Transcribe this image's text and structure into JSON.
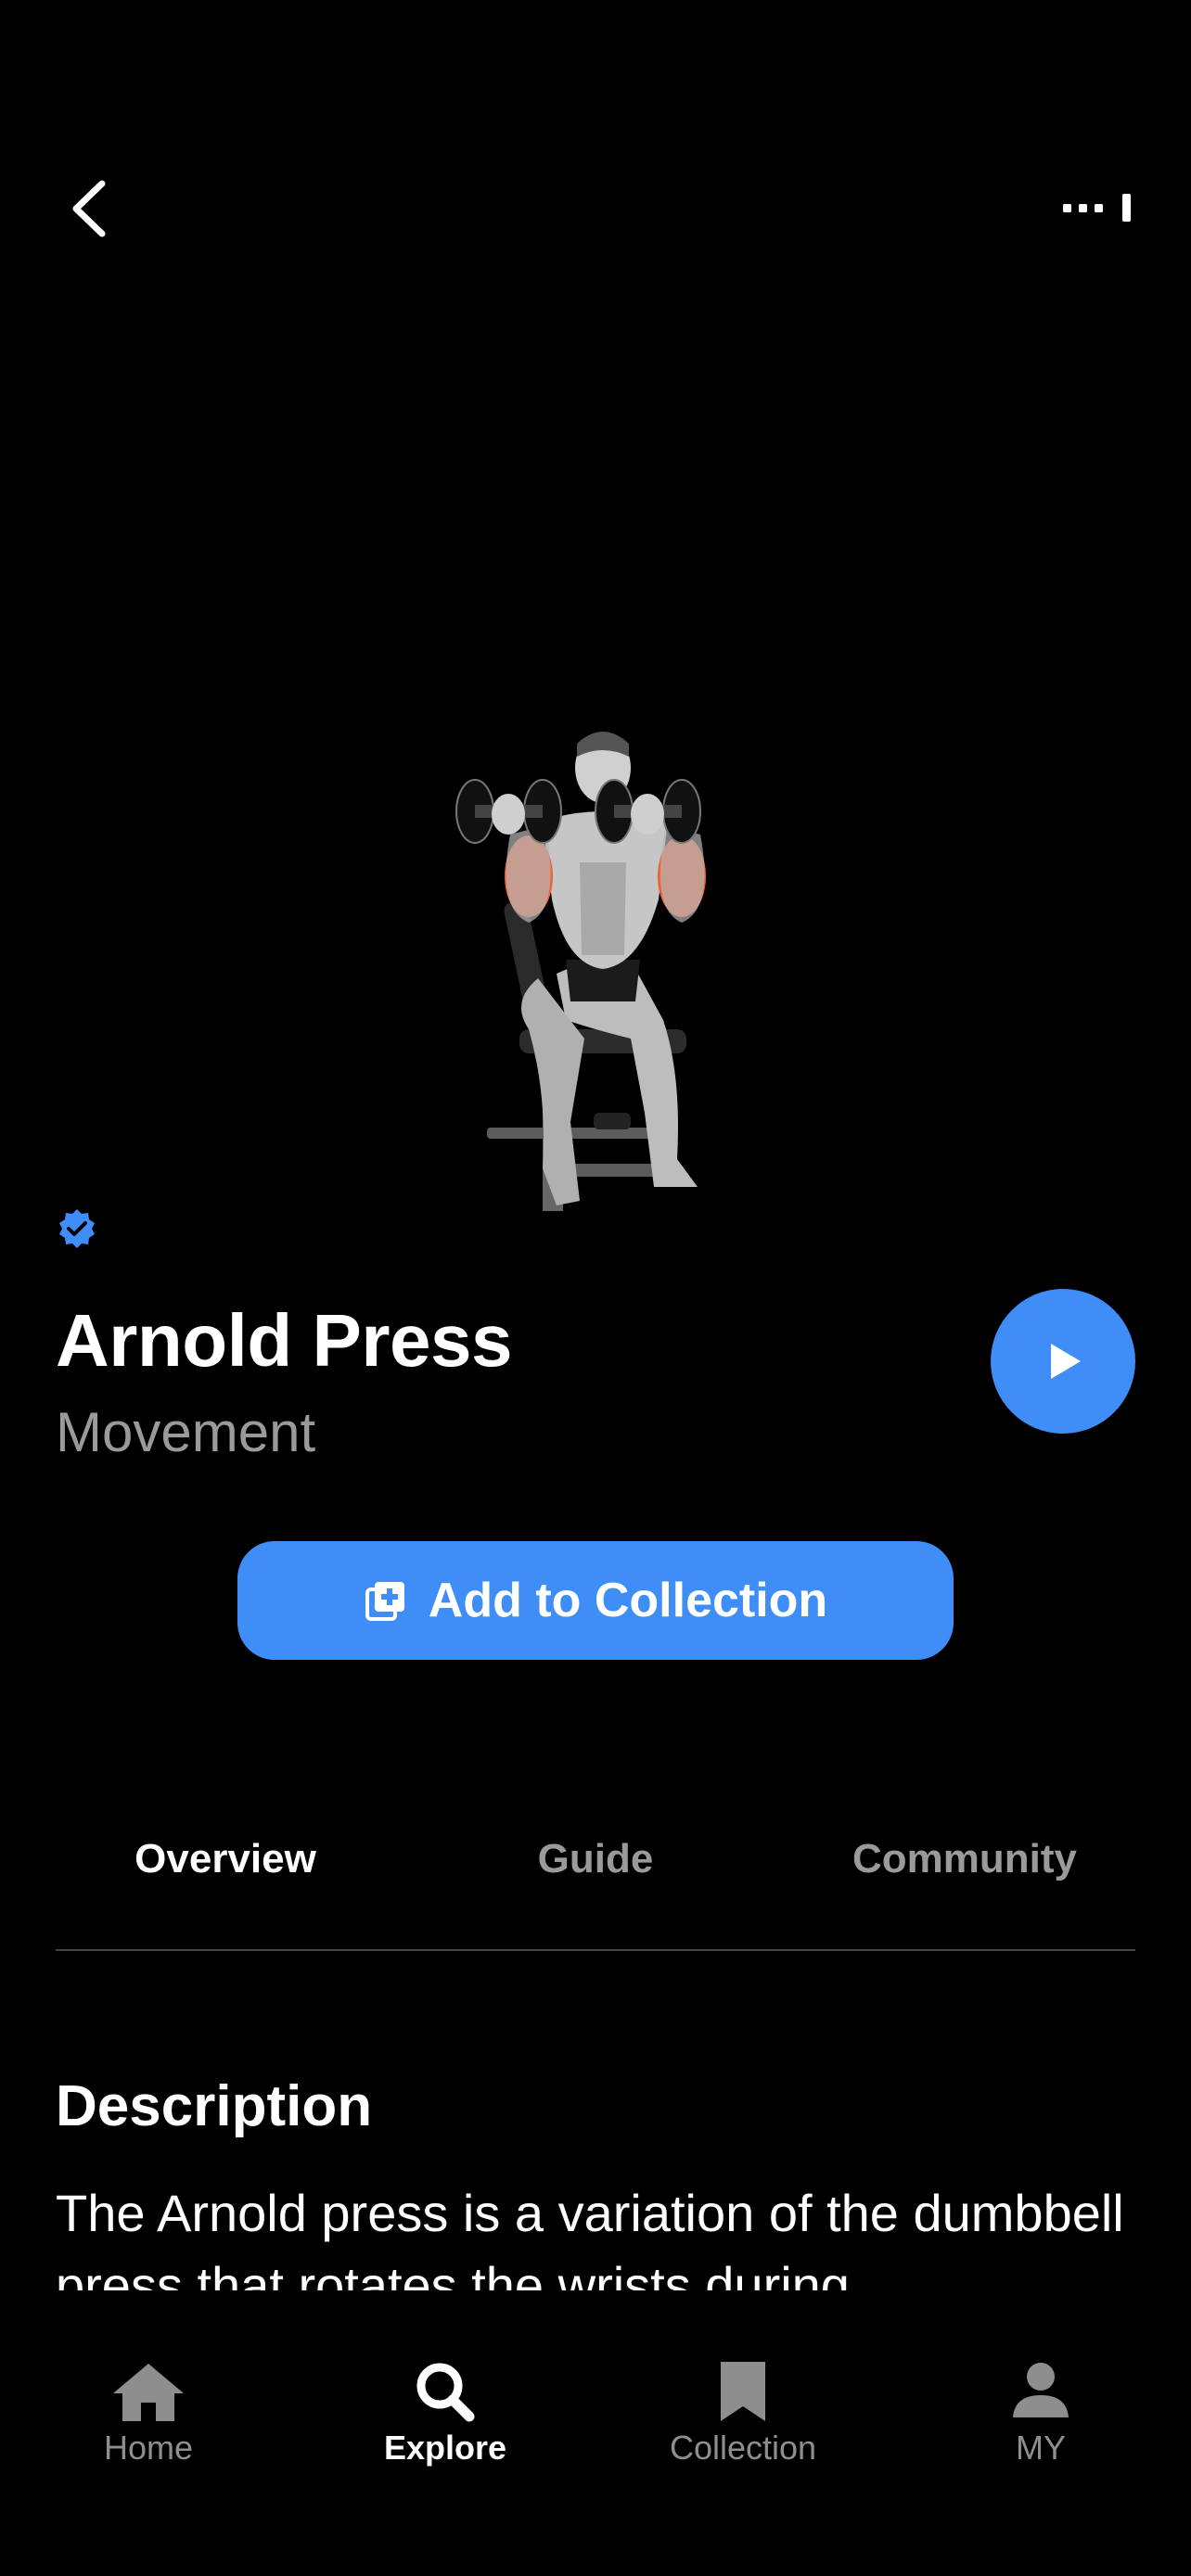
{
  "header": {
    "back_icon": "chevron-left-icon",
    "menu_icon": "more-icon"
  },
  "exercise": {
    "verified_icon": "verified-badge-icon",
    "title": "Arnold Press",
    "subtitle": "Movement",
    "play_icon": "play-icon"
  },
  "actions": {
    "add_label": "Add to Collection",
    "add_icon": "add-to-collection-icon"
  },
  "tabs": [
    {
      "label": "Overview",
      "active": true
    },
    {
      "label": "Guide",
      "active": false
    },
    {
      "label": "Community",
      "active": false
    }
  ],
  "description": {
    "heading": "Description",
    "body": "The Arnold press is a variation of the dumbbell press that rotates the wrists during"
  },
  "nav": [
    {
      "label": "Home",
      "icon": "home-icon"
    },
    {
      "label": "Explore",
      "icon": "search-icon",
      "active": true
    },
    {
      "label": "Collection",
      "icon": "bookmark-icon"
    },
    {
      "label": "MY",
      "icon": "person-icon"
    }
  ],
  "colors": {
    "accent": "#3f8ef7",
    "background": "#000000",
    "muscle_highlight": "#e8643a"
  }
}
